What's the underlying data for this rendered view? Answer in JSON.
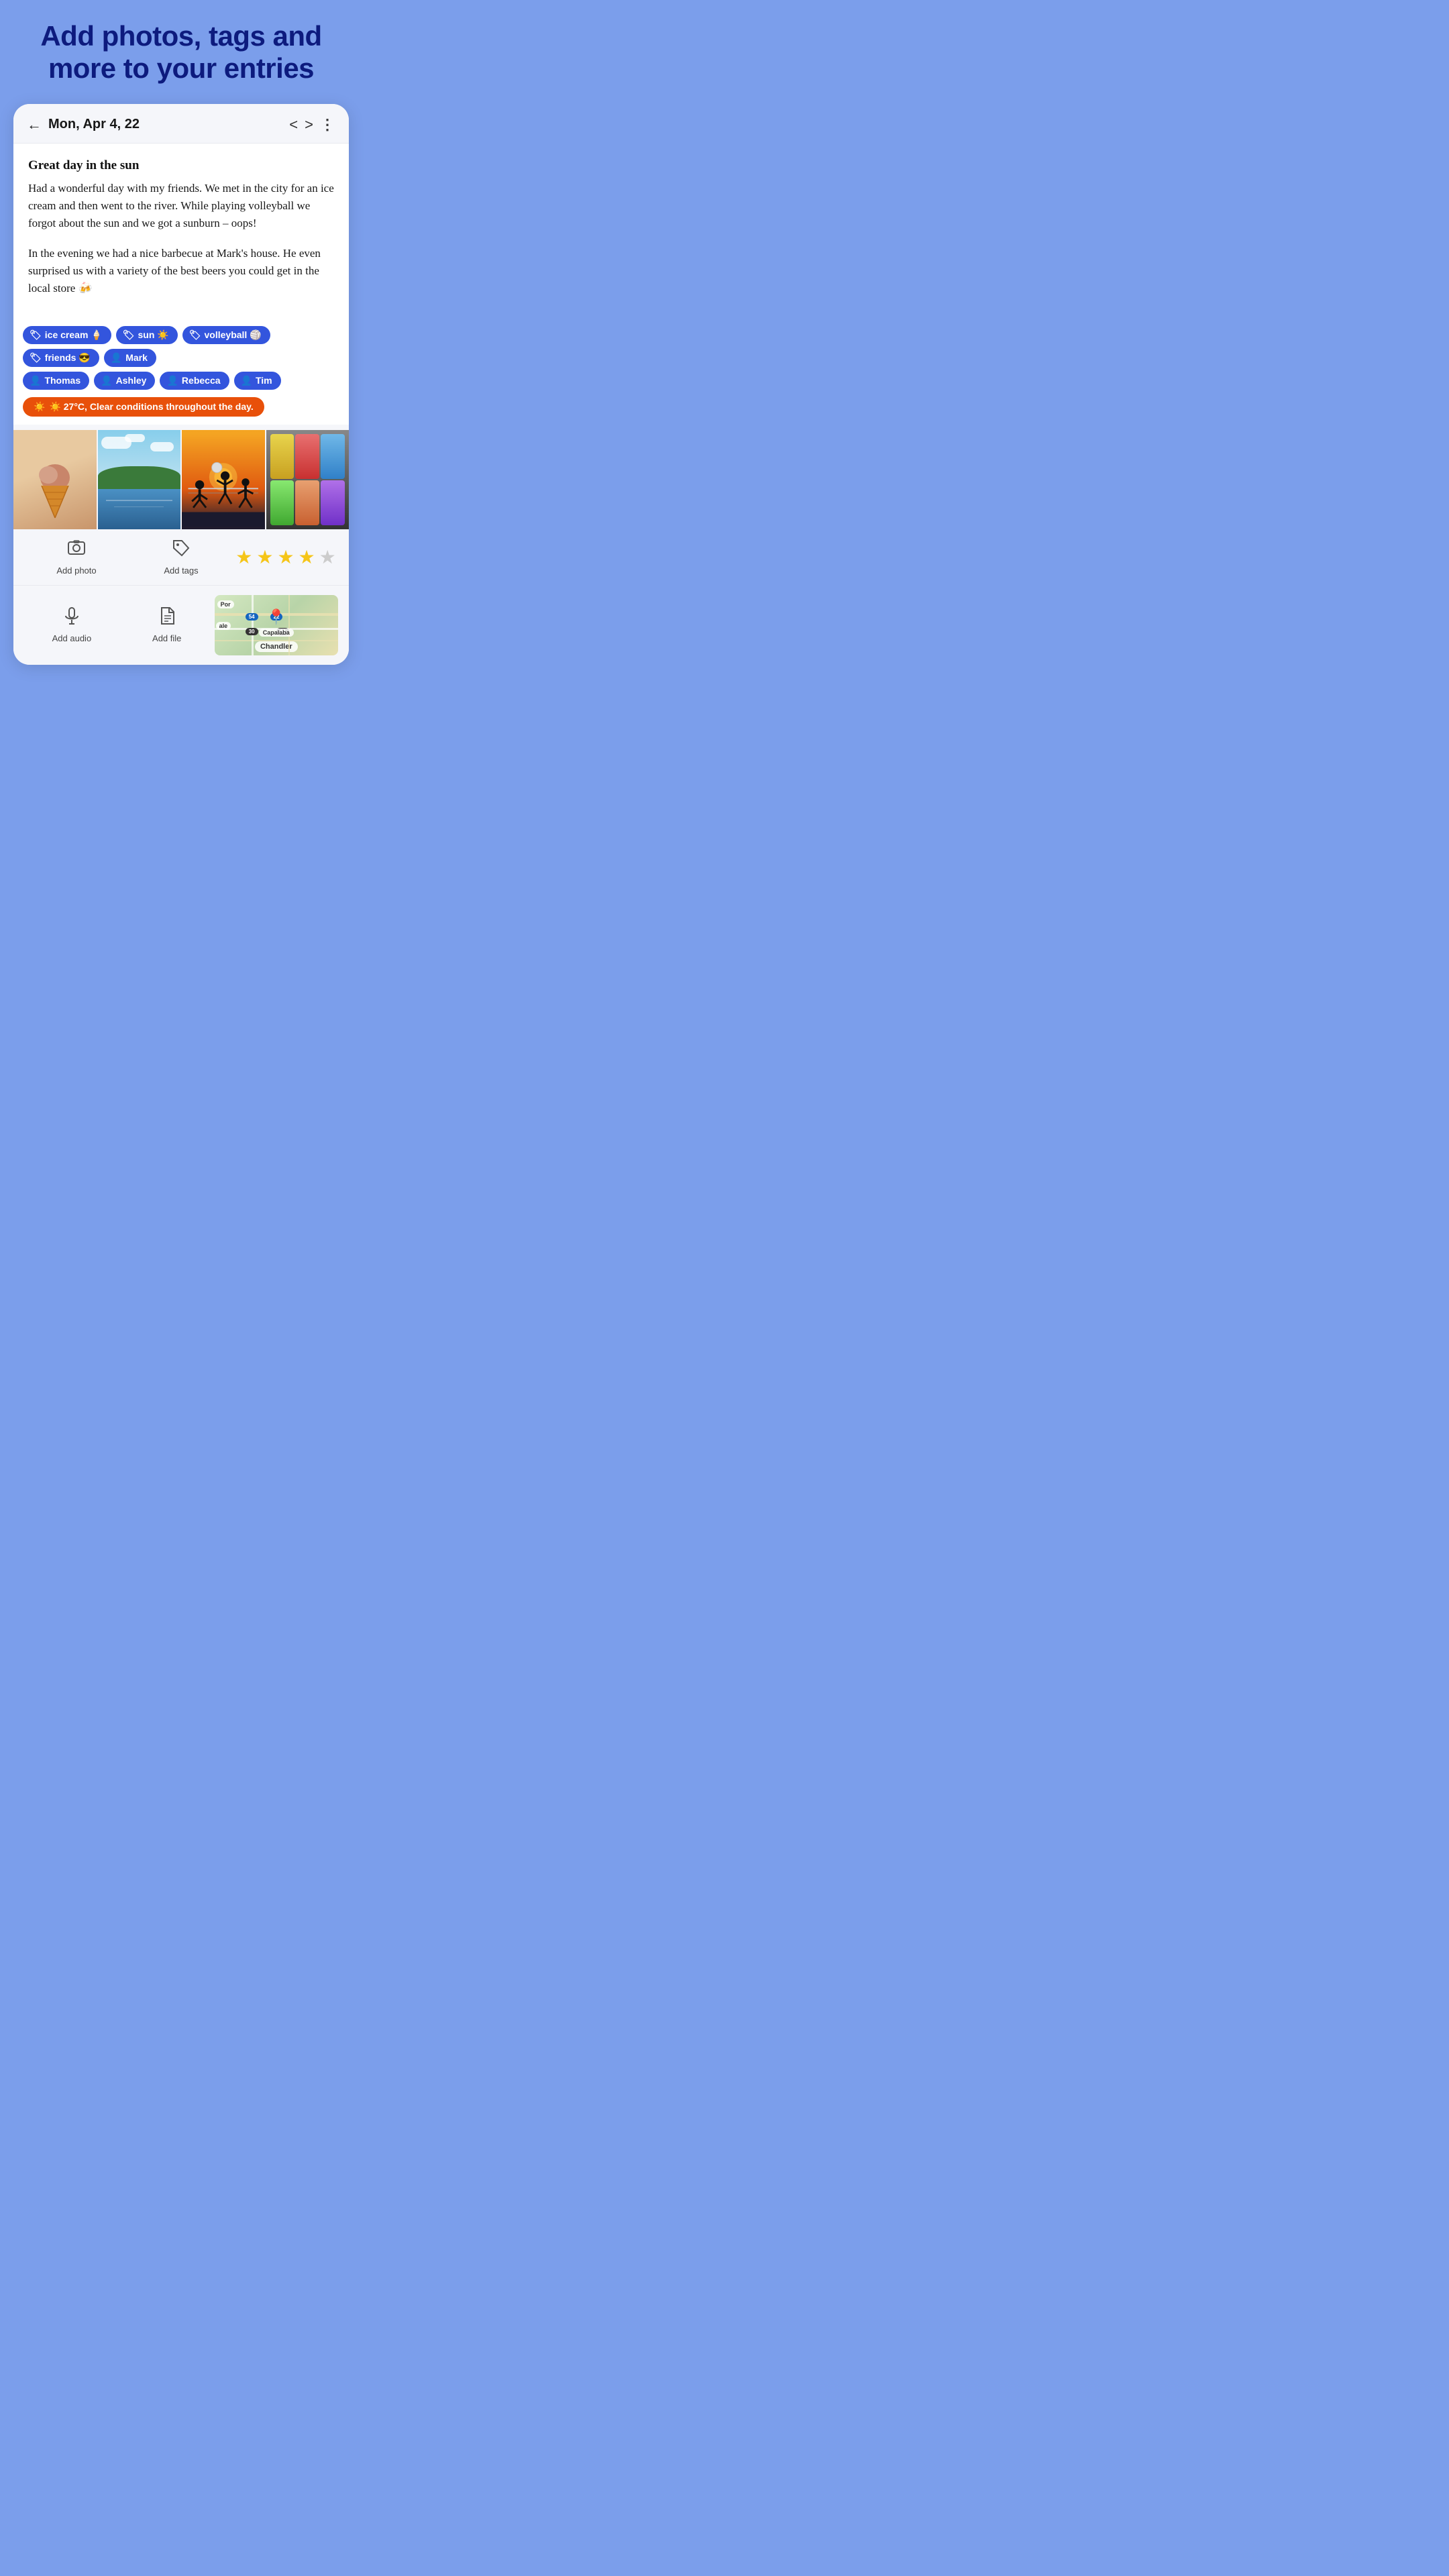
{
  "page": {
    "hero_title": "Add photos, tags and more to your entries",
    "background_color": "#7b9eeb"
  },
  "header": {
    "back_label": "←",
    "date": "Mon, Apr 4, 22",
    "prev_label": "<",
    "next_label": ">",
    "more_label": "⋮"
  },
  "entry": {
    "title": "Great day in the sun",
    "body_1": "Had a wonderful day with my friends. We met in the city for an ice cream and then went to the river. While playing volleyball we forgot about the sun and we got a sunburn – oops!",
    "body_2": "In the evening we had a nice barbecue at Mark's house. He even surprised us with a variety of the best beers you could get in the local store 🍻"
  },
  "tags": {
    "activity_tags": [
      {
        "icon": "🏷",
        "label": "ice cream 🍦"
      },
      {
        "icon": "🏷",
        "label": "sun ☀️"
      },
      {
        "icon": "🏷",
        "label": "volleyball 🏐"
      },
      {
        "icon": "🏷",
        "label": "friends 😎"
      },
      {
        "icon": "👤",
        "label": "Mark"
      }
    ],
    "person_tags": [
      {
        "icon": "👤",
        "label": "Thomas"
      },
      {
        "icon": "👤",
        "label": "Ashley"
      },
      {
        "icon": "👤",
        "label": "Rebecca"
      },
      {
        "icon": "👤",
        "label": "Tim"
      }
    ],
    "weather": "☀️ 27°C, Clear conditions throughout the day."
  },
  "photos": [
    {
      "id": "photo-icecream",
      "alt": "Ice cream cone"
    },
    {
      "id": "photo-river",
      "alt": "River with trees"
    },
    {
      "id": "photo-volleyball",
      "alt": "Volleyball silhouette at sunset"
    },
    {
      "id": "photo-beer",
      "alt": "Beer cans on shelf"
    }
  ],
  "actions": {
    "add_photo_label": "Add photo",
    "add_tags_label": "Add tags",
    "add_audio_label": "Add audio",
    "add_file_label": "Add file",
    "rating_stars": 4,
    "rating_total": 5,
    "map_location": "Chandler"
  },
  "icons": {
    "back": "←",
    "prev": "‹",
    "next": "›",
    "more": "⋮",
    "photo_icon": "🖼",
    "tag_icon": "🏷",
    "audio_icon": "🎤",
    "file_icon": "📄",
    "pin_icon": "📍"
  }
}
